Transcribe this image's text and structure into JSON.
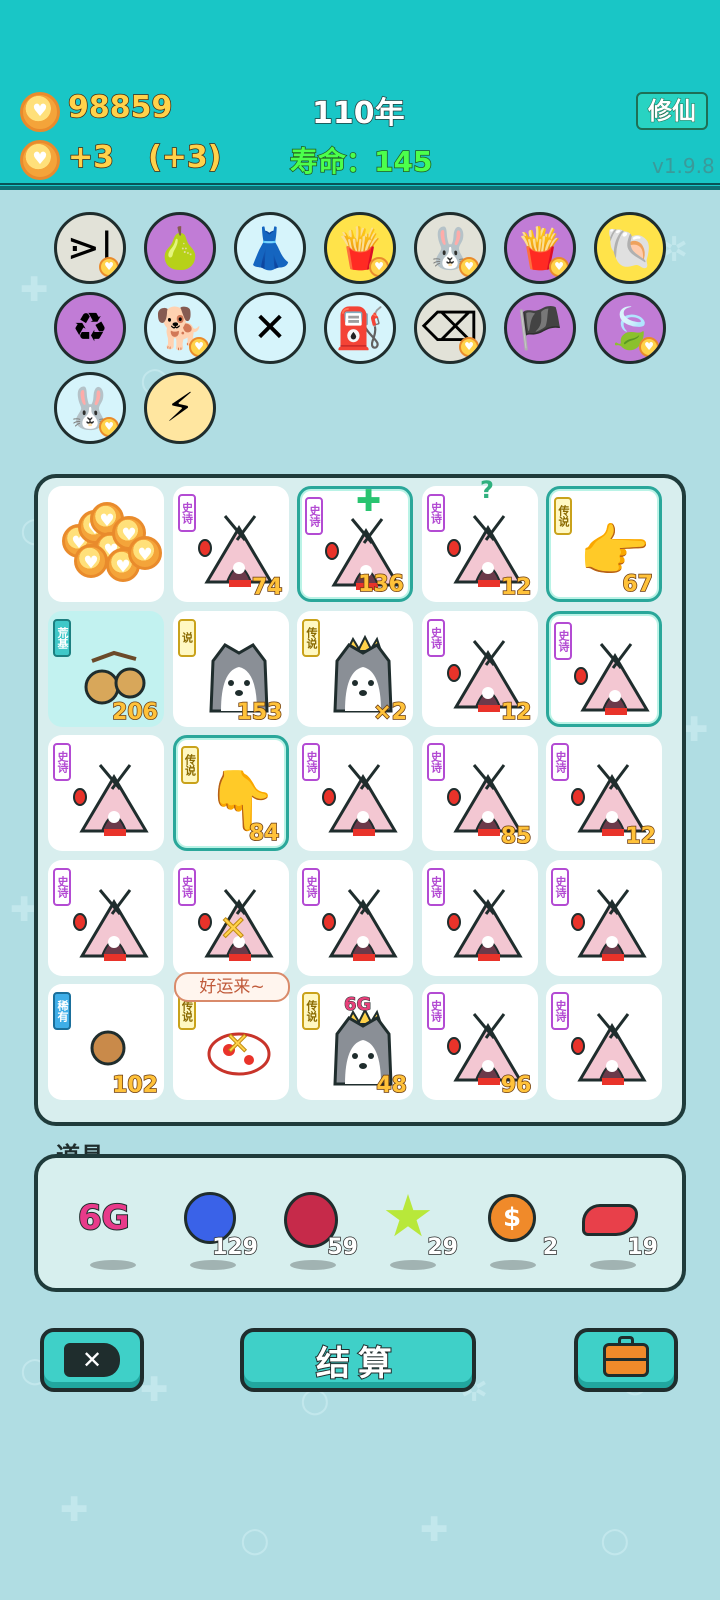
{
  "header": {
    "money": "98859",
    "income": "+3",
    "income_bonus": "(+3)",
    "year": "110年",
    "life": "寿命：145",
    "cultivate_button": "修仙",
    "version": "v1.9.8"
  },
  "skills": [
    {
      "icon": "skip-icon",
      "bg": "#e2e2d8",
      "glyph": "⋗|",
      "badge": true
    },
    {
      "icon": "grapefruit-icon",
      "bg": "#c17cd6",
      "glyph": "🍐",
      "badge": false
    },
    {
      "icon": "skirt-icon",
      "bg": "#d6f4fb",
      "glyph": "👗",
      "badge": false
    },
    {
      "icon": "fries-icon",
      "bg": "#ffe34a",
      "glyph": "🍟",
      "badge": true
    },
    {
      "icon": "rabbit-icon",
      "bg": "#e2e2d8",
      "glyph": "🐰",
      "badge": true
    },
    {
      "icon": "fries-icon",
      "bg": "#c17cd6",
      "glyph": "🍟",
      "badge": true
    },
    {
      "icon": "shell-icon",
      "bg": "#ffe34a",
      "glyph": "🐚",
      "badge": false
    },
    {
      "icon": "recycle-icon",
      "bg": "#c17cd6",
      "glyph": "♻",
      "badge": false
    },
    {
      "icon": "dog-icon",
      "bg": "#d6f4fb",
      "glyph": "🐕",
      "badge": true
    },
    {
      "icon": "chopsticks-icon",
      "bg": "#d6f4fb",
      "glyph": "✕",
      "badge": false
    },
    {
      "icon": "pump-icon",
      "bg": "#d6f4fb",
      "glyph": "⛽",
      "badge": false
    },
    {
      "icon": "delete-tag-icon",
      "bg": "#e2e2d8",
      "glyph": "⌫",
      "badge": true
    },
    {
      "icon": "eyepatch-icon",
      "bg": "#c17cd6",
      "glyph": "🏴",
      "badge": false
    },
    {
      "icon": "leaf-icon",
      "bg": "#c17cd6",
      "glyph": "🍃",
      "badge": true
    },
    {
      "icon": "rabbit-icon",
      "bg": "#d6f4fb",
      "glyph": "🐰",
      "badge": true
    },
    {
      "icon": "lightning-icon",
      "bg": "#ffe6a0",
      "glyph": "⚡",
      "badge": false
    }
  ],
  "board": [
    {
      "kind": "coins",
      "tag": "",
      "tagc": "",
      "num": "",
      "sel": false,
      "teal": false
    },
    {
      "kind": "house",
      "tag": "史诗",
      "tagc": "p",
      "num": "74",
      "sel": false,
      "teal": false
    },
    {
      "kind": "house",
      "tag": "史诗",
      "tagc": "p",
      "num": "136",
      "sel": true,
      "teal": false
    },
    {
      "kind": "house",
      "tag": "史诗",
      "tagc": "p",
      "num": "12",
      "sel": false,
      "teal": false
    },
    {
      "kind": "hand-right",
      "tag": "传说",
      "tagc": "y",
      "num": "67",
      "sel": true,
      "teal": false
    },
    {
      "kind": "longan",
      "tag": "荒基",
      "tagc": "t",
      "num": "206",
      "sel": false,
      "teal": true
    },
    {
      "kind": "husky",
      "tag": "说",
      "tagc": "y",
      "num": "153",
      "sel": false,
      "teal": false
    },
    {
      "kind": "husky-crown",
      "tag": "传说",
      "tagc": "y",
      "num": "×2",
      "sel": false,
      "teal": false
    },
    {
      "kind": "house",
      "tag": "史诗",
      "tagc": "p",
      "num": "12",
      "sel": false,
      "teal": false
    },
    {
      "kind": "house",
      "tag": "史诗",
      "tagc": "p",
      "num": "",
      "sel": true,
      "teal": false
    },
    {
      "kind": "house",
      "tag": "史诗",
      "tagc": "p",
      "num": "",
      "sel": false,
      "teal": false
    },
    {
      "kind": "hand-down",
      "tag": "传说",
      "tagc": "y",
      "num": "84",
      "sel": true,
      "teal": false
    },
    {
      "kind": "house",
      "tag": "史诗",
      "tagc": "p",
      "num": "",
      "sel": false,
      "teal": false
    },
    {
      "kind": "house",
      "tag": "史诗",
      "tagc": "p",
      "num": "85",
      "sel": false,
      "teal": false
    },
    {
      "kind": "house",
      "tag": "史诗",
      "tagc": "p",
      "num": "12",
      "sel": false,
      "teal": false
    },
    {
      "kind": "house",
      "tag": "史诗",
      "tagc": "p",
      "num": "",
      "sel": false,
      "teal": false
    },
    {
      "kind": "house-x",
      "tag": "史诗",
      "tagc": "p",
      "num": "",
      "sel": false,
      "teal": false
    },
    {
      "kind": "house",
      "tag": "史诗",
      "tagc": "p",
      "num": "",
      "sel": false,
      "teal": false
    },
    {
      "kind": "house",
      "tag": "史诗",
      "tagc": "p",
      "num": "",
      "sel": false,
      "teal": false
    },
    {
      "kind": "house",
      "tag": "史诗",
      "tagc": "p",
      "num": "",
      "sel": false,
      "teal": false
    },
    {
      "kind": "nut",
      "tag": "稀有",
      "tagc": "b",
      "num": "102",
      "sel": false,
      "teal": false
    },
    {
      "kind": "fish",
      "tag": "传说",
      "tagc": "y",
      "num": "",
      "sel": false,
      "teal": false
    },
    {
      "kind": "husky-crown",
      "tag": "传说",
      "tagc": "y",
      "num": "48",
      "sel": false,
      "teal": false
    },
    {
      "kind": "house",
      "tag": "史诗",
      "tagc": "p",
      "num": "96",
      "sel": false,
      "teal": false
    },
    {
      "kind": "house",
      "tag": "史诗",
      "tagc": "p",
      "num": "",
      "sel": false,
      "teal": false
    }
  ],
  "floating": {
    "good_luck": "好运来~",
    "sixg_label": "6G",
    "question": "?"
  },
  "props": {
    "title": "道具",
    "items": [
      {
        "icon": "6g-icon",
        "count": ""
      },
      {
        "icon": "blueberry-icon",
        "count": "129"
      },
      {
        "icon": "lychee-icon",
        "count": "59"
      },
      {
        "icon": "star-icon",
        "count": "29"
      },
      {
        "icon": "dollar-coin-icon",
        "count": "2"
      },
      {
        "icon": "liver-icon",
        "count": "19"
      }
    ]
  },
  "buttons": {
    "settle": "结算"
  }
}
